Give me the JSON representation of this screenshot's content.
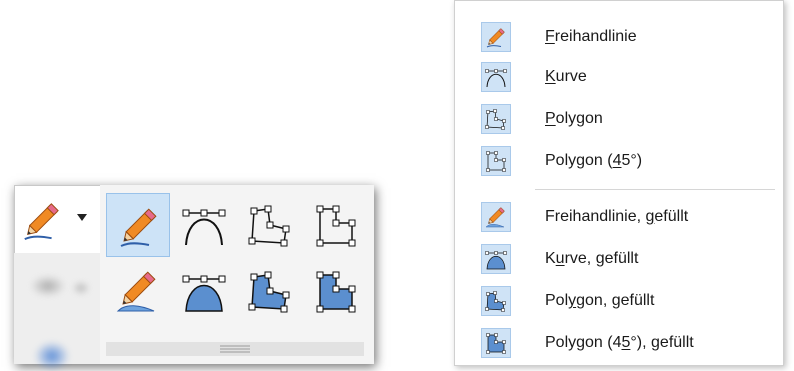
{
  "toolbar": {
    "current_tool": "pencil-icon",
    "tools_row1": [
      "freehand-line-icon",
      "curve-icon",
      "polygon-icon",
      "polygon-45-icon"
    ],
    "tools_row2": [
      "freehand-line-filled-icon",
      "curve-filled-icon",
      "polygon-filled-icon",
      "polygon-45-filled-icon"
    ],
    "selected_index": 0
  },
  "menu": {
    "items": [
      {
        "label_pre": "",
        "label_key": "F",
        "label_post": "reihandlinie",
        "icon": "freehand-line-icon"
      },
      {
        "label_pre": "",
        "label_key": "K",
        "label_post": "urve",
        "icon": "curve-icon"
      },
      {
        "label_pre": "",
        "label_key": "P",
        "label_post": "olygon",
        "icon": "polygon-icon"
      },
      {
        "label_pre": "Polygon (",
        "label_key": "4",
        "label_post": "5°)",
        "icon": "polygon-45-icon"
      },
      {
        "label_pre": "Freihandlinie, ",
        "label_key": "g",
        "label_post": "efüllt",
        "icon": "freehand-line-filled-icon"
      },
      {
        "label_pre": "K",
        "label_key": "u",
        "label_post": "rve, gefüllt",
        "icon": "curve-filled-icon"
      },
      {
        "label_pre": "Pol",
        "label_key": "y",
        "label_post": "gon, gefüllt",
        "icon": "polygon-filled-icon"
      },
      {
        "label_pre": "Polygon (4",
        "label_key": "5",
        "label_post": "°), gefüllt",
        "icon": "polygon-45-filled-icon"
      }
    ]
  },
  "colors": {
    "selection_bg": "#cde3f7",
    "selection_border": "#99c2ea",
    "fill_blue": "#5b8fcf",
    "pencil_orange": "#f08a24"
  }
}
